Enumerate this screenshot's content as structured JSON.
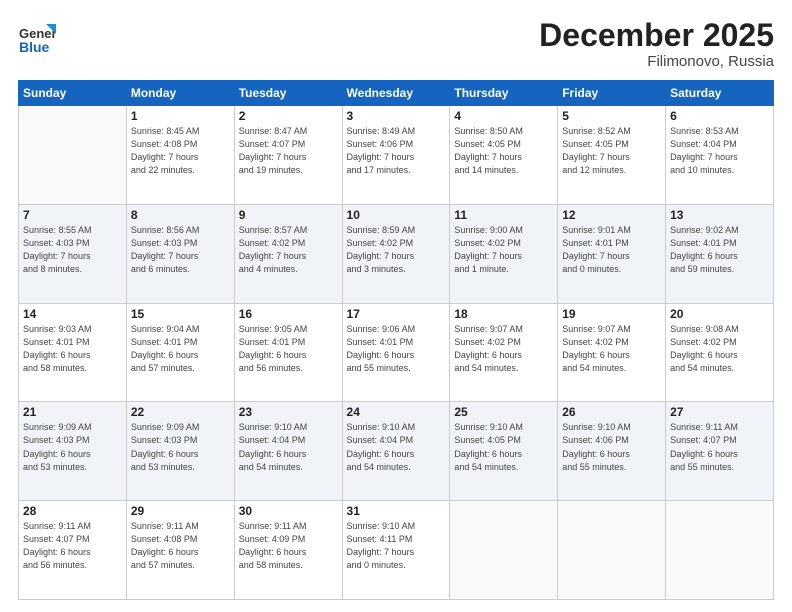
{
  "logo": {
    "general": "General",
    "blue": "Blue"
  },
  "title": "December 2025",
  "location": "Filimonovo, Russia",
  "days_header": [
    "Sunday",
    "Monday",
    "Tuesday",
    "Wednesday",
    "Thursday",
    "Friday",
    "Saturday"
  ],
  "weeks": [
    [
      {
        "num": "",
        "info": ""
      },
      {
        "num": "1",
        "info": "Sunrise: 8:45 AM\nSunset: 4:08 PM\nDaylight: 7 hours\nand 22 minutes."
      },
      {
        "num": "2",
        "info": "Sunrise: 8:47 AM\nSunset: 4:07 PM\nDaylight: 7 hours\nand 19 minutes."
      },
      {
        "num": "3",
        "info": "Sunrise: 8:49 AM\nSunset: 4:06 PM\nDaylight: 7 hours\nand 17 minutes."
      },
      {
        "num": "4",
        "info": "Sunrise: 8:50 AM\nSunset: 4:05 PM\nDaylight: 7 hours\nand 14 minutes."
      },
      {
        "num": "5",
        "info": "Sunrise: 8:52 AM\nSunset: 4:05 PM\nDaylight: 7 hours\nand 12 minutes."
      },
      {
        "num": "6",
        "info": "Sunrise: 8:53 AM\nSunset: 4:04 PM\nDaylight: 7 hours\nand 10 minutes."
      }
    ],
    [
      {
        "num": "7",
        "info": "Sunrise: 8:55 AM\nSunset: 4:03 PM\nDaylight: 7 hours\nand 8 minutes."
      },
      {
        "num": "8",
        "info": "Sunrise: 8:56 AM\nSunset: 4:03 PM\nDaylight: 7 hours\nand 6 minutes."
      },
      {
        "num": "9",
        "info": "Sunrise: 8:57 AM\nSunset: 4:02 PM\nDaylight: 7 hours\nand 4 minutes."
      },
      {
        "num": "10",
        "info": "Sunrise: 8:59 AM\nSunset: 4:02 PM\nDaylight: 7 hours\nand 3 minutes."
      },
      {
        "num": "11",
        "info": "Sunrise: 9:00 AM\nSunset: 4:02 PM\nDaylight: 7 hours\nand 1 minute."
      },
      {
        "num": "12",
        "info": "Sunrise: 9:01 AM\nSunset: 4:01 PM\nDaylight: 7 hours\nand 0 minutes."
      },
      {
        "num": "13",
        "info": "Sunrise: 9:02 AM\nSunset: 4:01 PM\nDaylight: 6 hours\nand 59 minutes."
      }
    ],
    [
      {
        "num": "14",
        "info": "Sunrise: 9:03 AM\nSunset: 4:01 PM\nDaylight: 6 hours\nand 58 minutes."
      },
      {
        "num": "15",
        "info": "Sunrise: 9:04 AM\nSunset: 4:01 PM\nDaylight: 6 hours\nand 57 minutes."
      },
      {
        "num": "16",
        "info": "Sunrise: 9:05 AM\nSunset: 4:01 PM\nDaylight: 6 hours\nand 56 minutes."
      },
      {
        "num": "17",
        "info": "Sunrise: 9:06 AM\nSunset: 4:01 PM\nDaylight: 6 hours\nand 55 minutes."
      },
      {
        "num": "18",
        "info": "Sunrise: 9:07 AM\nSunset: 4:02 PM\nDaylight: 6 hours\nand 54 minutes."
      },
      {
        "num": "19",
        "info": "Sunrise: 9:07 AM\nSunset: 4:02 PM\nDaylight: 6 hours\nand 54 minutes."
      },
      {
        "num": "20",
        "info": "Sunrise: 9:08 AM\nSunset: 4:02 PM\nDaylight: 6 hours\nand 54 minutes."
      }
    ],
    [
      {
        "num": "21",
        "info": "Sunrise: 9:09 AM\nSunset: 4:03 PM\nDaylight: 6 hours\nand 53 minutes."
      },
      {
        "num": "22",
        "info": "Sunrise: 9:09 AM\nSunset: 4:03 PM\nDaylight: 6 hours\nand 53 minutes."
      },
      {
        "num": "23",
        "info": "Sunrise: 9:10 AM\nSunset: 4:04 PM\nDaylight: 6 hours\nand 54 minutes."
      },
      {
        "num": "24",
        "info": "Sunrise: 9:10 AM\nSunset: 4:04 PM\nDaylight: 6 hours\nand 54 minutes."
      },
      {
        "num": "25",
        "info": "Sunrise: 9:10 AM\nSunset: 4:05 PM\nDaylight: 6 hours\nand 54 minutes."
      },
      {
        "num": "26",
        "info": "Sunrise: 9:10 AM\nSunset: 4:06 PM\nDaylight: 6 hours\nand 55 minutes."
      },
      {
        "num": "27",
        "info": "Sunrise: 9:11 AM\nSunset: 4:07 PM\nDaylight: 6 hours\nand 55 minutes."
      }
    ],
    [
      {
        "num": "28",
        "info": "Sunrise: 9:11 AM\nSunset: 4:07 PM\nDaylight: 6 hours\nand 56 minutes."
      },
      {
        "num": "29",
        "info": "Sunrise: 9:11 AM\nSunset: 4:08 PM\nDaylight: 6 hours\nand 57 minutes."
      },
      {
        "num": "30",
        "info": "Sunrise: 9:11 AM\nSunset: 4:09 PM\nDaylight: 6 hours\nand 58 minutes."
      },
      {
        "num": "31",
        "info": "Sunrise: 9:10 AM\nSunset: 4:11 PM\nDaylight: 7 hours\nand 0 minutes."
      },
      {
        "num": "",
        "info": ""
      },
      {
        "num": "",
        "info": ""
      },
      {
        "num": "",
        "info": ""
      }
    ]
  ]
}
